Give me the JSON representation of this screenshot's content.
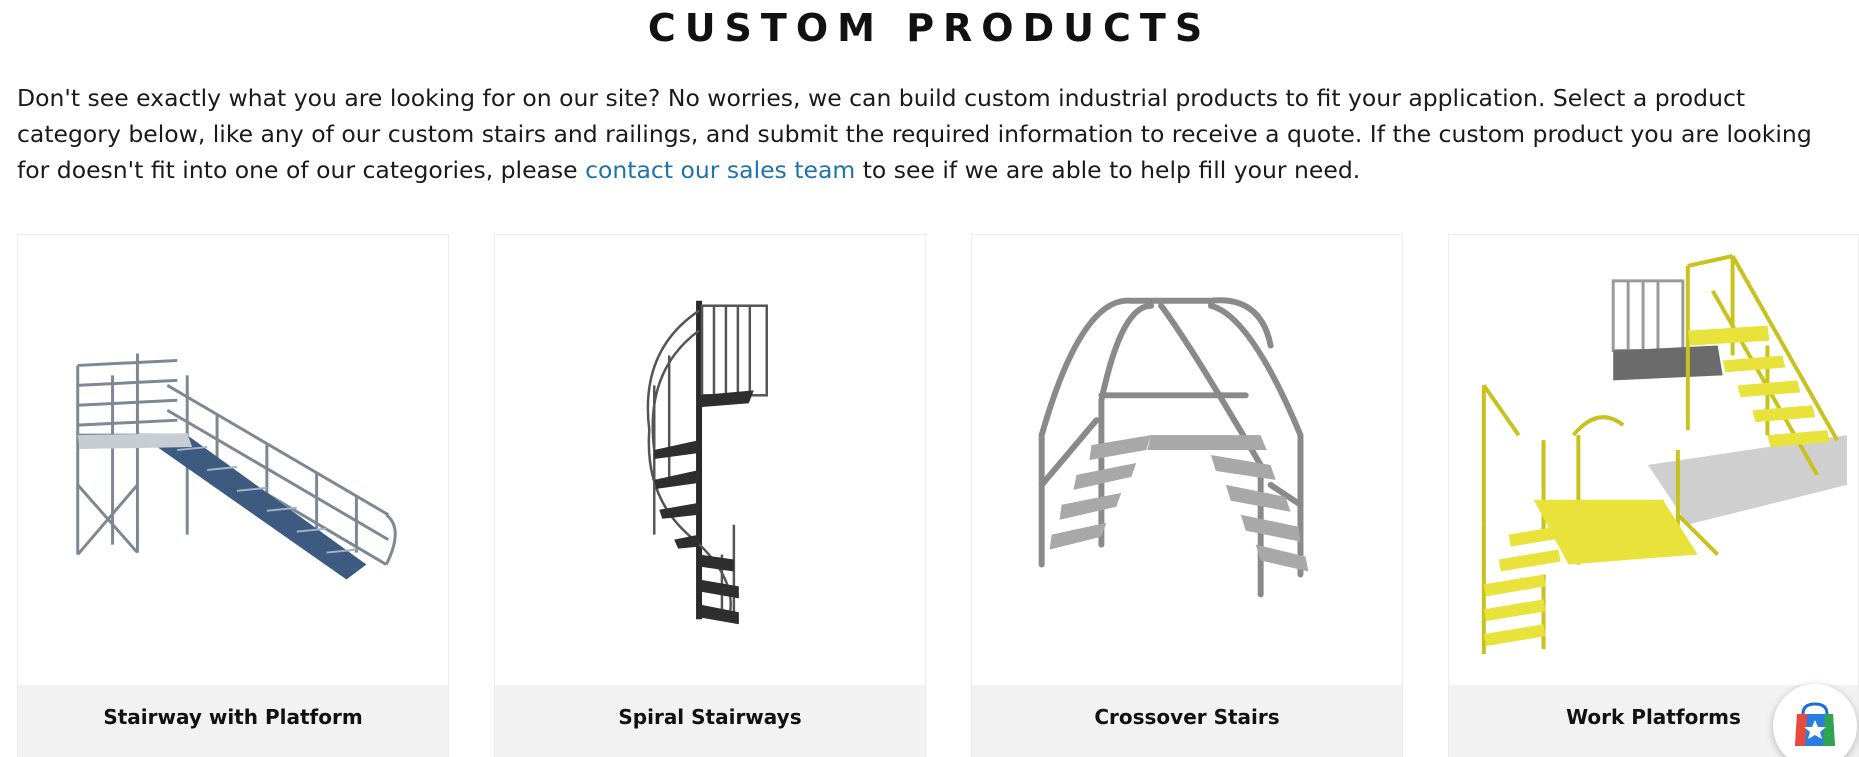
{
  "page": {
    "title": "CUSTOM PRODUCTS",
    "intro_before_link": "Don't see exactly what you are looking for on our site? No worries, we can build custom industrial products to fit your application. Select a product category below, like any of our custom stairs and railings, and submit the required information to receive a quote. If the custom product you are looking for doesn't fit into one of our categories, please ",
    "intro_link": "contact our sales team",
    "intro_after_link": " to see if we are able to help fill your need."
  },
  "products": [
    {
      "label": "Stairway with Platform",
      "icon": "stairway-platform-image"
    },
    {
      "label": "Spiral Stairways",
      "icon": "spiral-stairway-image"
    },
    {
      "label": "Crossover Stairs",
      "icon": "crossover-stairs-image"
    },
    {
      "label": "Work Platforms",
      "icon": "work-platforms-image"
    }
  ],
  "floating_badge": {
    "icon": "shopping-bag-star-icon"
  },
  "colors": {
    "link": "#1f73a8",
    "label_bar": "#f2f2f2",
    "platform_yellow": "#e8e23a"
  }
}
